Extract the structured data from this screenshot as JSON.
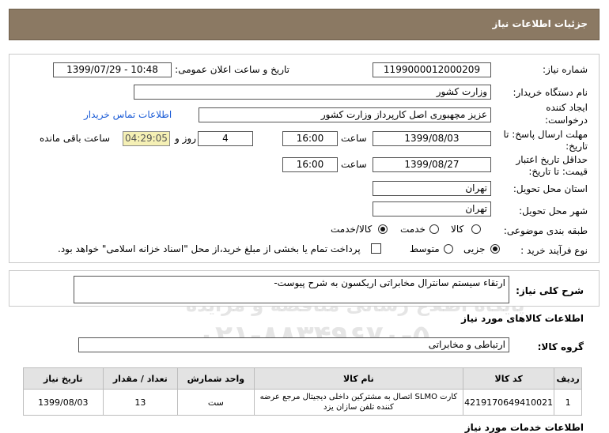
{
  "header": {
    "title": "جزئیات اطلاعات نیاز"
  },
  "watermark": {
    "line1": "ParsNamadData",
    "line2": "پایگاه اطلاع رسانی مناقصه و مزایده",
    "phone": "۰۲۱-۸۸۳۴۹۶۷۰-۵"
  },
  "form": {
    "need_number_label": "شماره نیاز:",
    "need_number": "1199000012000209",
    "announce_label": "تاریخ و ساعت اعلان عمومی:",
    "announce_value": "1399/07/29 - 10:48",
    "buyer_label": "نام دستگاه خریدار:",
    "buyer_value": "وزارت کشور",
    "requester_label": "ایجاد کننده درخواست:",
    "requester_value": "عزیز مچهبوری اصل کارپرداز وزارت کشور",
    "contact_link": "اطلاعات تماس خریدار",
    "deadline_label": "مهلت ارسال پاسخ: تا تاریخ:",
    "deadline_date": "1399/08/03",
    "time_label": "ساعت",
    "deadline_time": "16:00",
    "days_value": "4",
    "days_label": "روز و",
    "timer_value": "04:29:05",
    "remaining_label": "ساعت باقی مانده",
    "validity_label": "حداقل تاریخ اعتبار قیمت: تا تاریخ:",
    "validity_date": "1399/08/27",
    "validity_time": "16:00",
    "province_label": "استان محل تحویل:",
    "province_value": "تهران",
    "city_label": "شهر محل تحویل:",
    "city_value": "تهران",
    "category_label": "طبقه بندی موضوعی:",
    "category_options": [
      "کالا",
      "خدمت",
      "کالا/خدمت"
    ],
    "purchase_label": "نوع فرآیند خرید :",
    "purchase_options": [
      "جزیی",
      "متوسط"
    ],
    "payment_note": "پرداخت تمام یا بخشی از مبلغ خرید،از محل \"اسناد خزانه اسلامی\" خواهد بود."
  },
  "summary": {
    "label": "شرح کلی نیاز:",
    "value": "ارتقاء سیستم سانترال مخابراتی اریکسون به شرح پیوست-"
  },
  "goods": {
    "section_title": "اطلاعات کالاهای مورد نیاز",
    "group_label": "گروه کالا:",
    "group_value": "ارتباطی و مخابراتی",
    "columns": [
      "ردیف",
      "کد کالا",
      "نام کالا",
      "واحد شمارش",
      "تعداد / مقدار",
      "تاریخ نیاز"
    ],
    "rows": [
      {
        "row": "1",
        "code": "4219170649410021",
        "name": "کارت SLMO اتصال به مشترکین داخلی دیجیتال مرجع عرضه کننده تلفن سازان یزد",
        "unit": "ست",
        "qty": "13",
        "date": "1399/08/03"
      }
    ]
  },
  "services": {
    "section_title": "اطلاعات خدمات مورد نیاز"
  }
}
